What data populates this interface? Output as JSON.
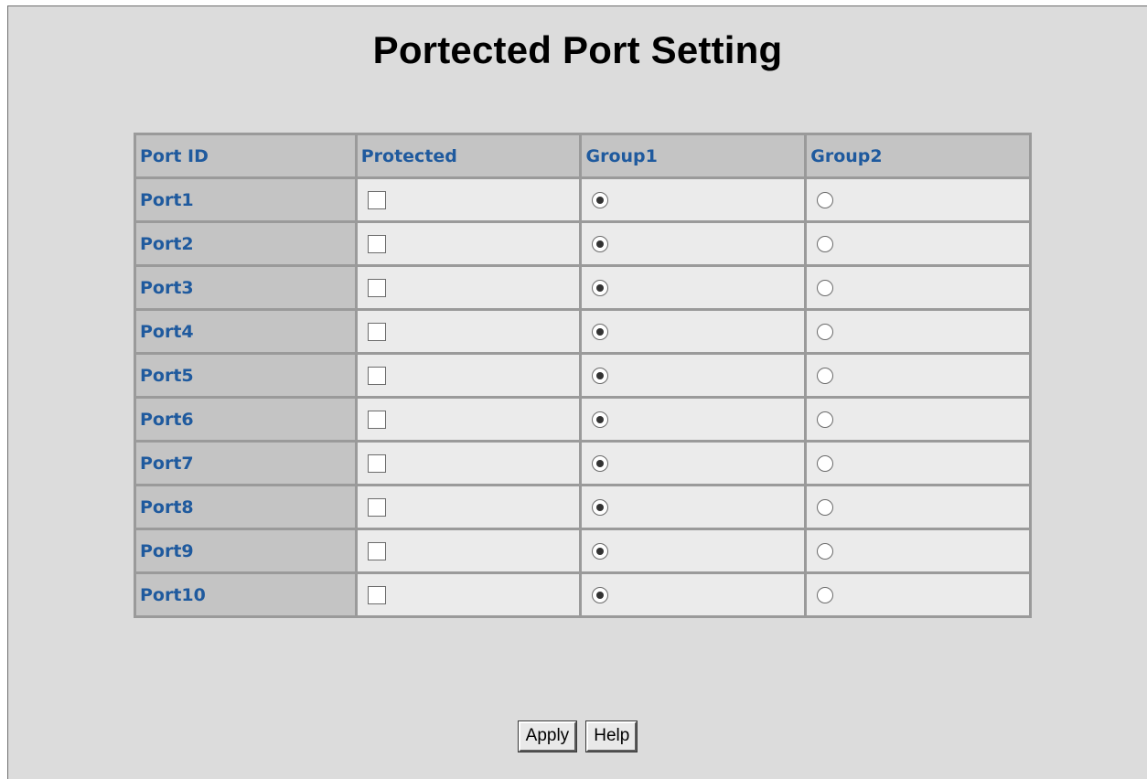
{
  "page": {
    "title": "Portected Port Setting"
  },
  "table": {
    "headers": [
      "Port ID",
      "Protected",
      "Group1",
      "Group2"
    ],
    "rows": [
      {
        "port": "Port1",
        "protected": false,
        "group": "Group1"
      },
      {
        "port": "Port2",
        "protected": false,
        "group": "Group1"
      },
      {
        "port": "Port3",
        "protected": false,
        "group": "Group1"
      },
      {
        "port": "Port4",
        "protected": false,
        "group": "Group1"
      },
      {
        "port": "Port5",
        "protected": false,
        "group": "Group1"
      },
      {
        "port": "Port6",
        "protected": false,
        "group": "Group1"
      },
      {
        "port": "Port7",
        "protected": false,
        "group": "Group1"
      },
      {
        "port": "Port8",
        "protected": false,
        "group": "Group1"
      },
      {
        "port": "Port9",
        "protected": false,
        "group": "Group1"
      },
      {
        "port": "Port10",
        "protected": false,
        "group": "Group1"
      }
    ]
  },
  "buttons": {
    "apply_label": "Apply",
    "help_label": "Help"
  },
  "colors": {
    "background": "#dcdcdc",
    "header_cell": "#c4c4c4",
    "data_cell": "#ebebeb",
    "header_text": "#1f5a9e",
    "grid": "#9a9a9a"
  }
}
